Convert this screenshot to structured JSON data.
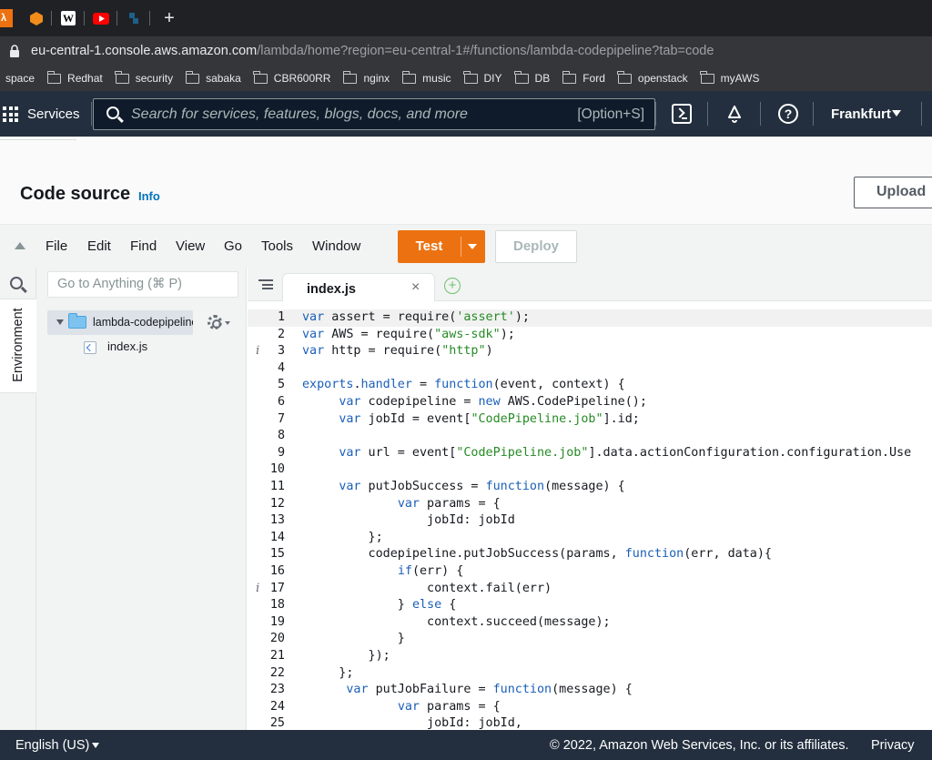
{
  "browser": {
    "url_host": "eu-central-1.console.aws.amazon.com",
    "url_path": "/lambda/home?region=eu-central-1#/functions/lambda-codepipeline?tab=code",
    "new_tab": "+",
    "bookmarks": [
      "space",
      "Redhat",
      "security",
      "sabaka",
      "CBR600RR",
      "nginx",
      "music",
      "DIY",
      "DB",
      "Ford",
      "openstack",
      "myAWS"
    ]
  },
  "nav": {
    "services": "Services",
    "search_placeholder": "Search for services, features, blogs, docs, and more",
    "search_shortcut": "[Option+S]",
    "help": "?",
    "region": "Frankfurt"
  },
  "panel": {
    "title": "Code source",
    "info": "Info",
    "upload": "Upload"
  },
  "menu": {
    "items": [
      "File",
      "Edit",
      "Find",
      "View",
      "Go",
      "Tools",
      "Window"
    ],
    "test": "Test",
    "deploy": "Deploy"
  },
  "sidebar": {
    "environment": "Environment",
    "goto_placeholder": "Go to Anything (⌘ P)",
    "folder": "lambda-codepipeline",
    "file": "index.js"
  },
  "editor": {
    "tab": "index.js",
    "tab_close": "×",
    "new_tab": "+",
    "info_marker": "i",
    "lines": [
      "var assert = require('assert');",
      "var AWS = require(\"aws-sdk\");",
      "var http = require(\"http\")",
      "",
      "exports.handler = function(event, context) {",
      "     var codepipeline = new AWS.CodePipeline();",
      "     var jobId = event[\"CodePipeline.job\"].id;",
      "",
      "     var url = event[\"CodePipeline.job\"].data.actionConfiguration.configuration.Use",
      "",
      "     var putJobSuccess = function(message) {",
      "             var params = {",
      "                 jobId: jobId",
      "         };",
      "         codepipeline.putJobSuccess(params, function(err, data){",
      "             if(err) {",
      "                 context.fail(err)",
      "             } else {",
      "                 context.succeed(message);",
      "             }",
      "         });",
      "     };",
      "      var putJobFailure = function(message) {",
      "             var params = {",
      "                 jobId: jobId,"
    ]
  },
  "footer": {
    "language": "English (US)",
    "copyright": "© 2022, Amazon Web Services, Inc. or its affiliates.",
    "privacy": "Privacy"
  }
}
